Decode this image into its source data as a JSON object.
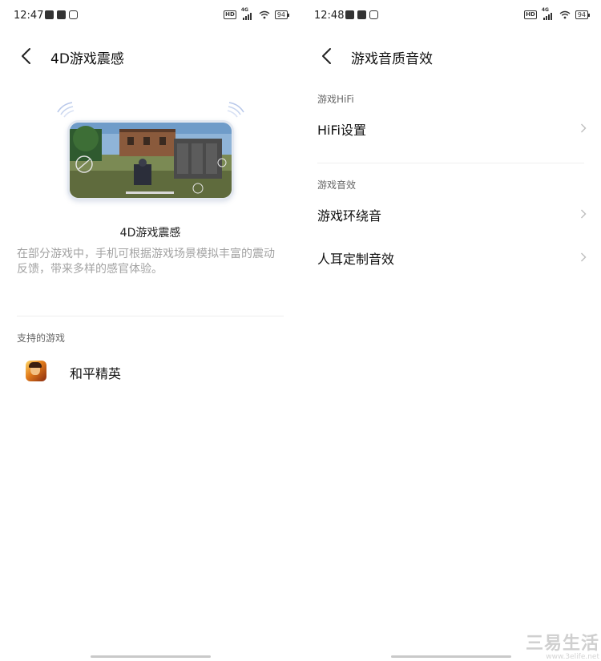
{
  "left_screen": {
    "status_bar": {
      "time": "12:47",
      "network": "4G",
      "battery": "94"
    },
    "header": {
      "title": "4D游戏震感"
    },
    "feature": {
      "title": "4D游戏震感",
      "description": "在部分游戏中，手机可根据游戏场景模拟丰富的震动反馈，带来多样的感官体验。"
    },
    "supported": {
      "section_label": "支持的游戏",
      "games": [
        {
          "name": "和平精英"
        }
      ]
    }
  },
  "right_screen": {
    "status_bar": {
      "time": "12:48",
      "network": "4G",
      "battery": "94"
    },
    "header": {
      "title": "游戏音质音效"
    },
    "sections": [
      {
        "label": "游戏HiFi",
        "items": [
          {
            "label": "HiFi设置"
          }
        ]
      },
      {
        "label": "游戏音效",
        "items": [
          {
            "label": "游戏环绕音"
          },
          {
            "label": "人耳定制音效"
          }
        ]
      }
    ]
  },
  "watermark": {
    "text": "三易生活",
    "url": "www.3elife.net"
  },
  "colors": {
    "accent_wave": "#9db3e0",
    "secondary_text": "#a3a3a3",
    "divider": "#eeeeee"
  },
  "icons": [
    "back-arrow-icon",
    "chevron-right-icon",
    "wifi-icon",
    "battery-icon",
    "vibration-wave-icon"
  ]
}
